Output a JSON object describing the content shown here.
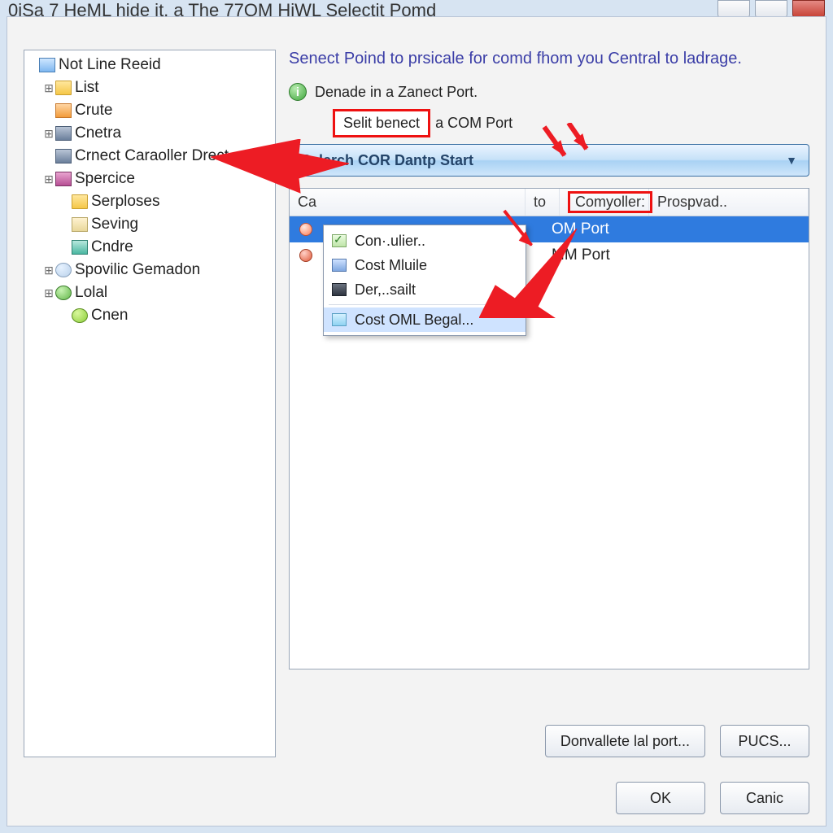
{
  "window": {
    "title": "0iSa 7 HeML hide it, a The 77OM HiWL Selectit Pomd"
  },
  "instruction": "Senect Poind to prsicale for comd fhom you Central to ladrage.",
  "info_line": "Denade in a Zanect Port.",
  "selit": {
    "boxed": "Selit benect",
    "after": "a COM Port"
  },
  "combo_label": "Selerch COR Dantp Start",
  "menu": {
    "items": [
      {
        "label": "Con·.ulier.."
      },
      {
        "label": "Cost Mluile"
      },
      {
        "label": "Der,..sailt"
      },
      {
        "label": "Cost OML Begal..."
      }
    ]
  },
  "table": {
    "head": {
      "c1": "Ca",
      "c2": "to",
      "c3_boxed": "Comyoller:",
      "c3_after": "Prospvad.."
    },
    "rows": [
      {
        "right": "OM Port",
        "selected": true
      },
      {
        "right": "MM Port",
        "selected": false
      }
    ]
  },
  "buttons": {
    "donval": "Donvallete lal port...",
    "pucs": "PUCS...",
    "ok": "OK",
    "cancel": "Canic"
  },
  "tree": [
    {
      "depth": 0,
      "icon": "i-root",
      "twisty": "",
      "label": "Not Line Reeid"
    },
    {
      "depth": 1,
      "icon": "i-folder",
      "twisty": "⊞",
      "label": "List"
    },
    {
      "depth": 1,
      "icon": "i-orange",
      "twisty": "",
      "label": "Crute"
    },
    {
      "depth": 1,
      "icon": "i-slate",
      "twisty": "⊞",
      "label": "Cnetra"
    },
    {
      "depth": 1,
      "icon": "i-slate",
      "twisty": "",
      "label": "Crnect Caraoller Drect"
    },
    {
      "depth": 1,
      "icon": "i-magenta",
      "twisty": "⊞",
      "label": "Spercice"
    },
    {
      "depth": 2,
      "icon": "i-folder",
      "twisty": "",
      "label": "Serploses"
    },
    {
      "depth": 2,
      "icon": "i-cream",
      "twisty": "",
      "label": "Seving"
    },
    {
      "depth": 2,
      "icon": "i-teal",
      "twisty": "",
      "label": "Cndre"
    },
    {
      "depth": 1,
      "icon": "i-globe",
      "twisty": "⊞",
      "label": "Spovilic Gemadon"
    },
    {
      "depth": 1,
      "icon": "i-green",
      "twisty": "⊞",
      "label": "Lolal"
    },
    {
      "depth": 2,
      "icon": "i-lime",
      "twisty": "",
      "label": "Cnen"
    }
  ]
}
